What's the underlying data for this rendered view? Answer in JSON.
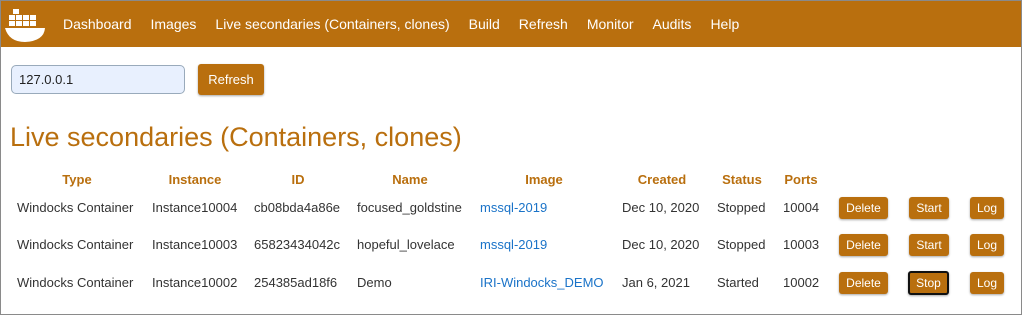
{
  "nav": {
    "items": [
      "Dashboard",
      "Images",
      "Live secondaries (Containers, clones)",
      "Build",
      "Refresh",
      "Monitor",
      "Audits",
      "Help"
    ]
  },
  "host": {
    "value": "127.0.0.1"
  },
  "refresh_label": "Refresh",
  "page_title": "Live secondaries (Containers, clones)",
  "table": {
    "headers": [
      "Type",
      "Instance",
      "ID",
      "Name",
      "Image",
      "Created",
      "Status",
      "Ports"
    ],
    "rows": [
      {
        "type": "Windocks Container",
        "instance": "Instance10004",
        "id": "cb08bda4a86e",
        "name": "focused_goldstine",
        "image": "mssql-2019",
        "created": "Dec 10, 2020",
        "status": "Stopped",
        "ports": "10004",
        "delete": "Delete",
        "action": "Start",
        "log": "Log"
      },
      {
        "type": "Windocks Container",
        "instance": "Instance10003",
        "id": "65823434042c",
        "name": "hopeful_lovelace",
        "image": "mssql-2019",
        "created": "Dec 10, 2020",
        "status": "Stopped",
        "ports": "10003",
        "delete": "Delete",
        "action": "Start",
        "log": "Log"
      },
      {
        "type": "Windocks Container",
        "instance": "Instance10002",
        "id": "254385ad18f6",
        "name": "Demo",
        "image": "IRI-Windocks_DEMO",
        "created": "Jan 6, 2021",
        "status": "Started",
        "ports": "10002",
        "delete": "Delete",
        "action": "Stop",
        "log": "Log"
      }
    ]
  },
  "colors": {
    "brand": "#b96f0e",
    "link": "#1a73c8"
  },
  "icons": {
    "logo": "whale-logo-icon"
  }
}
